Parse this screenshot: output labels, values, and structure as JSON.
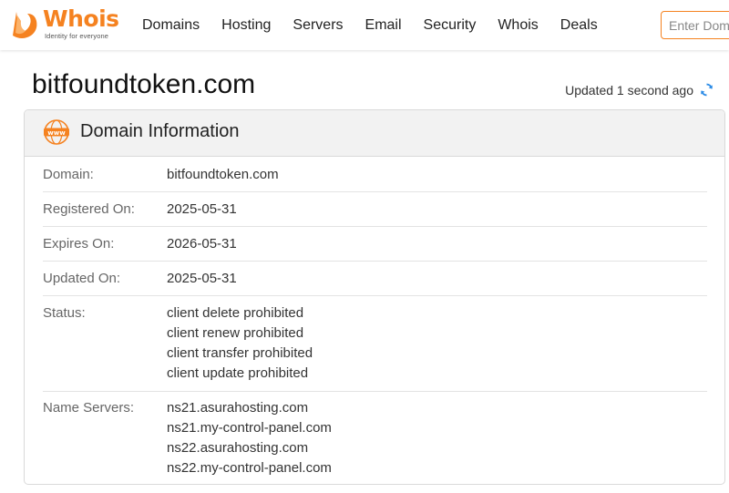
{
  "brand": {
    "name_part1": "Who",
    "name_part2": "is",
    "tagline": "Identity for everyone"
  },
  "nav": {
    "items": [
      "Domains",
      "Hosting",
      "Servers",
      "Email",
      "Security",
      "Whois",
      "Deals"
    ]
  },
  "search": {
    "placeholder": "Enter Domain or IP"
  },
  "page": {
    "title": "bitfoundtoken.com",
    "updated_text": "Updated 1 second ago"
  },
  "card": {
    "title": "Domain Information",
    "icon_text": "www",
    "rows": [
      {
        "label": "Domain:",
        "values": [
          "bitfoundtoken.com"
        ]
      },
      {
        "label": "Registered On:",
        "values": [
          "2025-05-31"
        ]
      },
      {
        "label": "Expires On:",
        "values": [
          "2026-05-31"
        ]
      },
      {
        "label": "Updated On:",
        "values": [
          "2025-05-31"
        ]
      },
      {
        "label": "Status:",
        "values": [
          "client delete prohibited",
          "client renew prohibited",
          "client transfer prohibited",
          "client update prohibited"
        ]
      },
      {
        "label": "Name Servers:",
        "values": [
          "ns21.asurahosting.com",
          "ns21.my-control-panel.com",
          "ns22.asurahosting.com",
          "ns22.my-control-panel.com"
        ]
      }
    ]
  },
  "colors": {
    "accent": "#f58220",
    "refresh": "#2b8be6"
  }
}
